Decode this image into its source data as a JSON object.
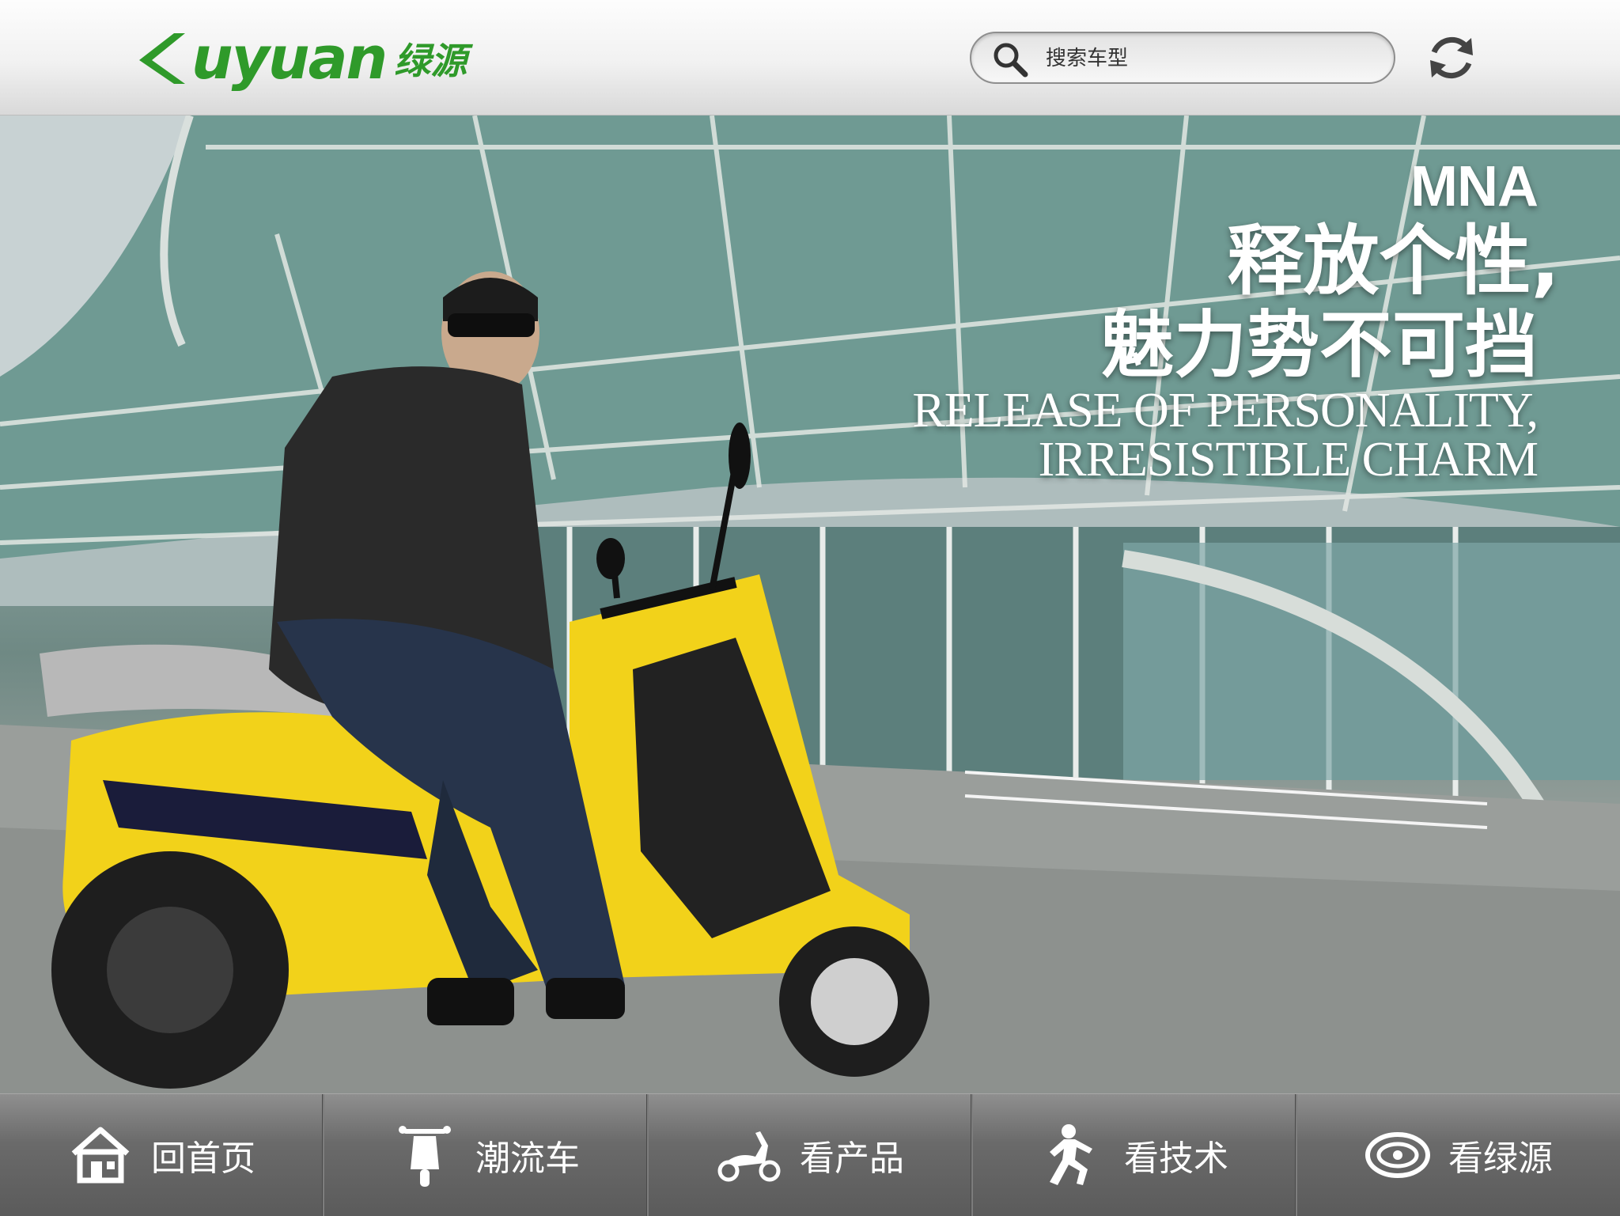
{
  "header": {
    "logo_word": "uyuan",
    "logo_cn": "绿源",
    "search_placeholder": "搜索车型",
    "icons": {
      "search": "search-icon",
      "refresh": "refresh-icon"
    }
  },
  "hero": {
    "model": "MNA",
    "headline_cn_1": "释放个性,",
    "headline_cn_2": "魅力势不可挡",
    "headline_en_1": "RELEASE OF PERSONALITY,",
    "headline_en_2": "IRRESISTIBLE CHARM"
  },
  "nav": {
    "items": [
      {
        "label": "回首页",
        "icon": "home-icon"
      },
      {
        "label": "潮流车",
        "icon": "scooter-front-icon"
      },
      {
        "label": "看产品",
        "icon": "scooter-side-icon"
      },
      {
        "label": "看技术",
        "icon": "runner-icon"
      },
      {
        "label": "看绿源",
        "icon": "brand-icon"
      }
    ]
  },
  "colors": {
    "brand_green": "#2f9a2a",
    "nav_bg": "#6a6a6a",
    "scooter_yellow": "#f2d21a"
  }
}
